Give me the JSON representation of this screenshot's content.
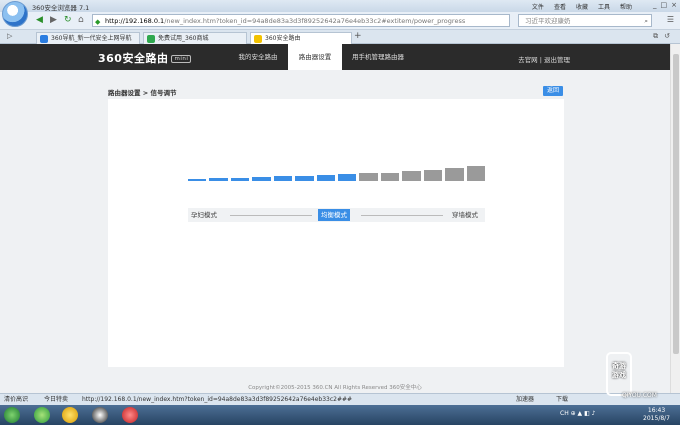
{
  "browser": {
    "title": "360安全浏览器 7.1",
    "menus": [
      "文件",
      "查看",
      "收藏",
      "工具",
      "帮助"
    ],
    "window_controls": [
      "_",
      "□",
      "×"
    ],
    "url_host": "http://192.168.0.1",
    "url_rest": "/new_index.htm?token_id=94a8de83a3d3f89252642a76e4eb33c2#extitem/power_progress",
    "search_placeholder": "习近平欢迎康奶"
  },
  "tabs": [
    {
      "label": "360导航_新一代安全上网导航",
      "color": "#2b7de0"
    },
    {
      "label": "免费试用_360商城",
      "color": "#2fa84f"
    },
    {
      "label": "360安全路由",
      "color": "#f2c200"
    }
  ],
  "router": {
    "brand": "360安全路由",
    "brand_badge": "mini",
    "nav": [
      "我的安全路由",
      "路由器设置",
      "用手机管理路由器"
    ],
    "links": "去官网 | 退出管理",
    "breadcrumb": "路由器设置 > 信号调节",
    "back": "返回",
    "modes": [
      "孕妇模式",
      "均衡模式",
      "穿墙模式"
    ],
    "active_mode_index": 1,
    "signal_level": 0.5,
    "copyright": "Copyright©2005-2015 360.CN All Rights Reserved 360安全中心"
  },
  "status": {
    "left1": "清价高识",
    "left2": "今日特卖",
    "url": "http://192.168.0.1/new_index.htm?token_id=94a8de83a3d3f89252642a76e4eb33c2###",
    "accelerate": "加速器",
    "download": "下载"
  },
  "taskbar": {
    "time": "16:43",
    "date": "2015/8/7"
  },
  "watermark": {
    "logo_text": "奇游\n游戏",
    "site": "QIYOU.COM"
  },
  "colors": {
    "accent": "#3a8ee6",
    "bar_inactive": "#9a9a9a",
    "header": "#2b2b2b"
  }
}
